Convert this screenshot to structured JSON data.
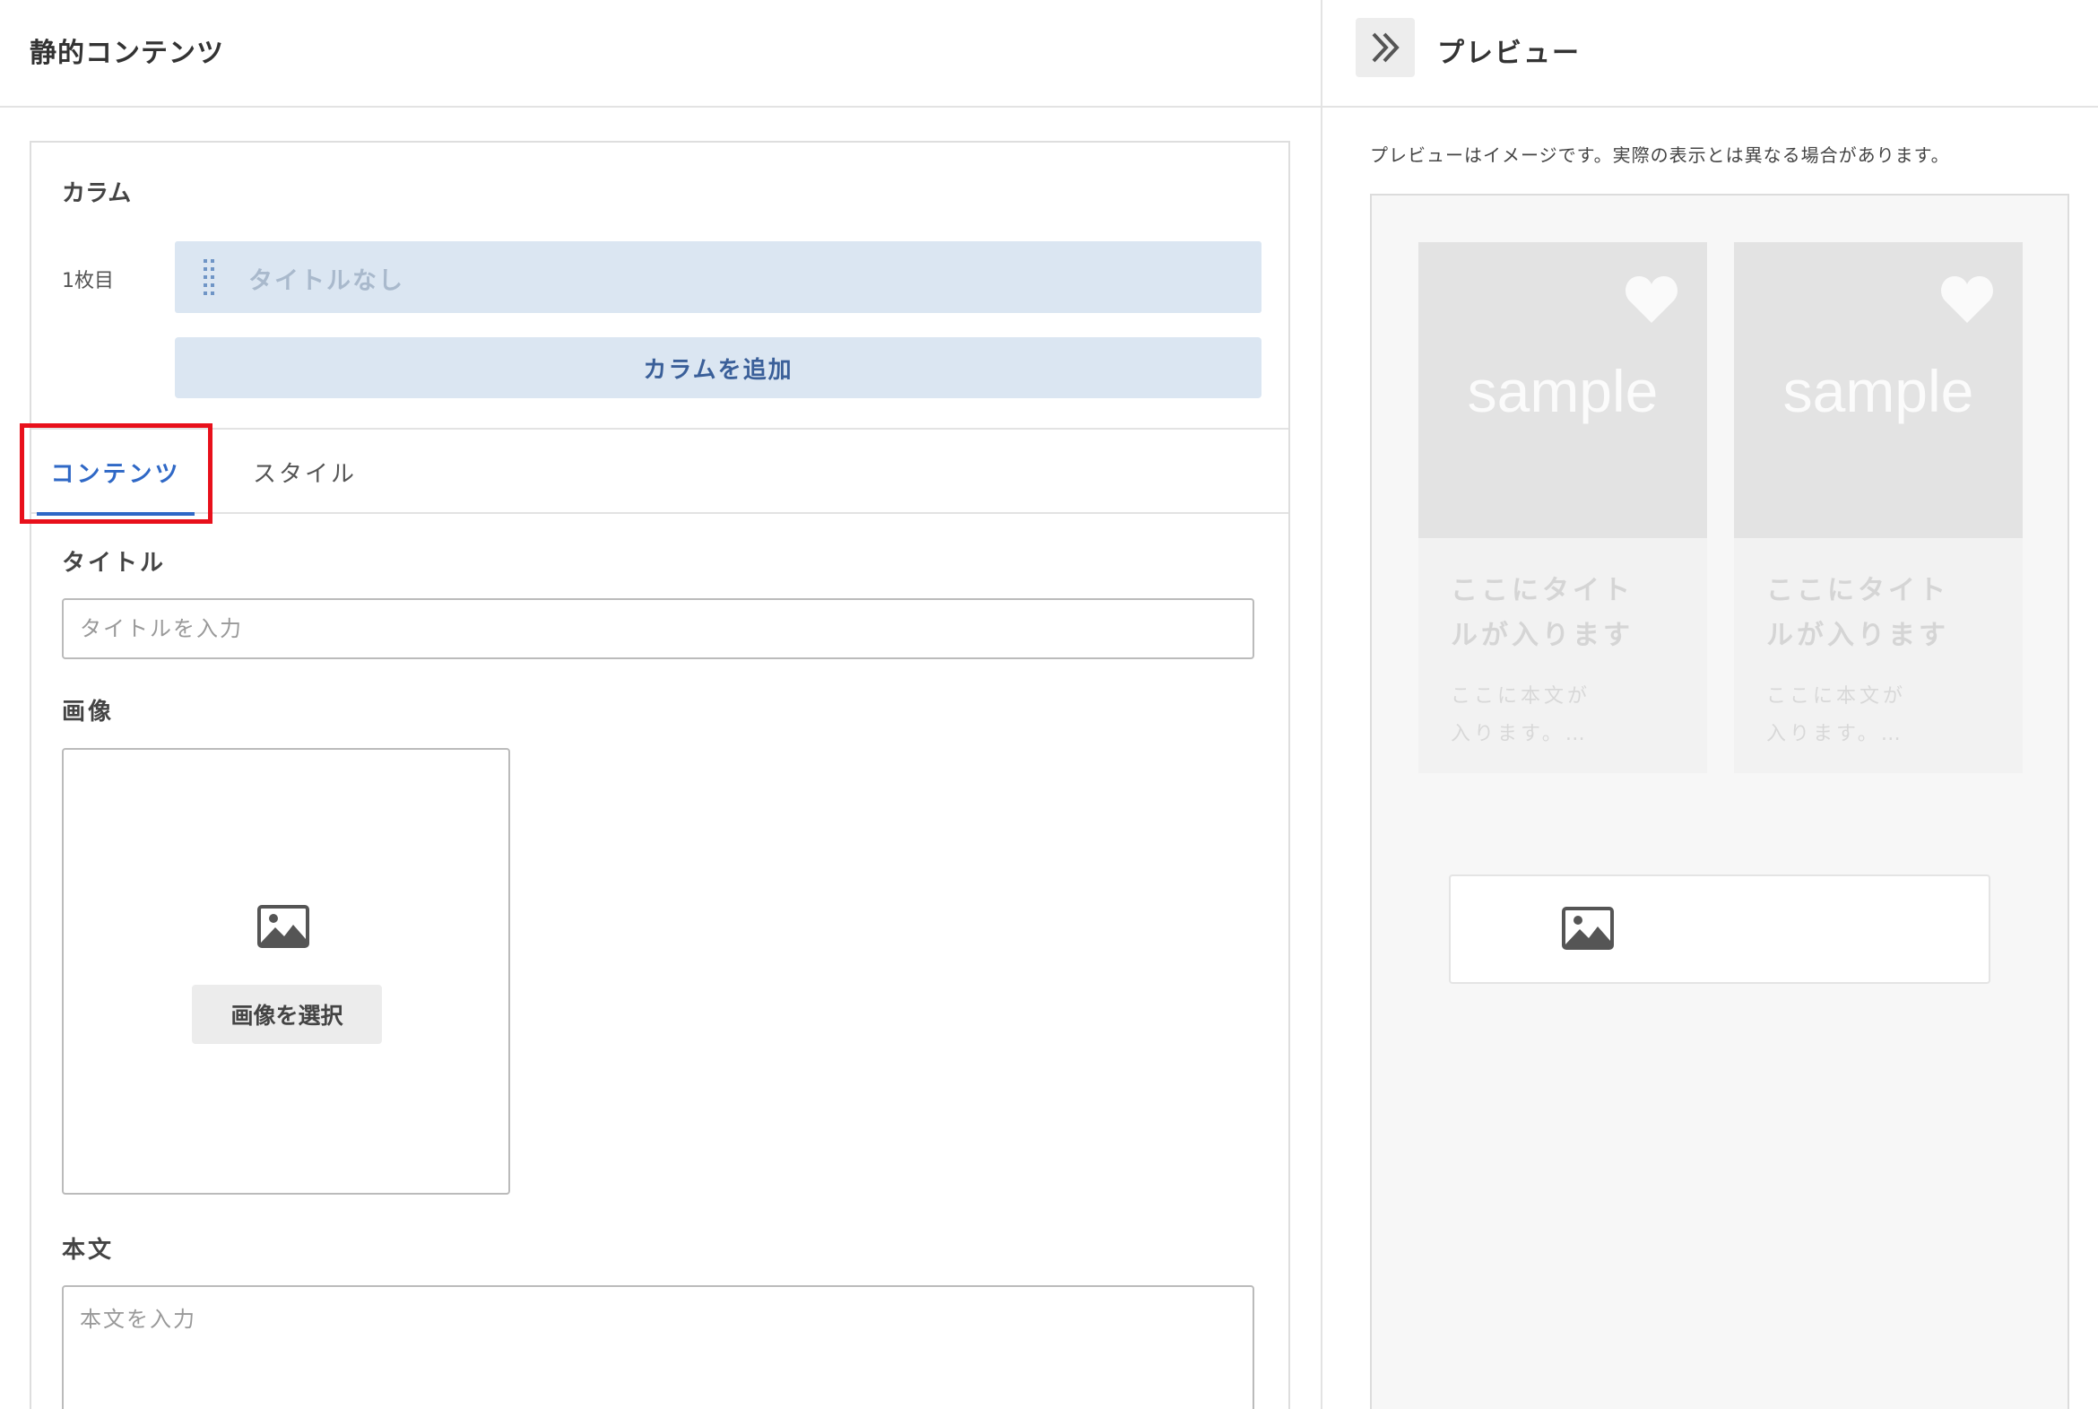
{
  "editor": {
    "title": "静的コンテンツ",
    "column_section_label": "カラム",
    "columns": [
      {
        "label": "1枚目",
        "title": "タイトルなし"
      }
    ],
    "add_column_label": "カラムを追加",
    "tabs": [
      {
        "label": "コンテンツ",
        "active": true
      },
      {
        "label": "スタイル",
        "active": false
      }
    ],
    "title_field": {
      "label": "タイトル",
      "placeholder": "タイトルを入力",
      "value": ""
    },
    "image_field": {
      "label": "画像",
      "icon": "image-icon",
      "button_label": "画像を選択"
    },
    "body_field": {
      "label": "本文",
      "placeholder": "本文を入力",
      "value": ""
    },
    "highlight_color": "#e8101b",
    "accent_color": "#2f68c6"
  },
  "preview": {
    "toggle_icon": "double-chevron-right-icon",
    "title": "プレビュー",
    "note": "プレビューはイメージです。実際の表示とは異なる場合があります。",
    "cards": [
      {
        "image_text": "sample",
        "icon": "heart-icon",
        "title_line1": "ここにタイト",
        "title_line2": "ルが入ります",
        "text_line1": "ここに本文が",
        "text_line2": "入ります。…"
      },
      {
        "image_text": "sample",
        "icon": "heart-icon",
        "title_line1": "ここにタイト",
        "title_line2": "ルが入ります",
        "text_line1": "ここに本文が",
        "text_line2": "入ります。…"
      }
    ],
    "image_placeholder_icon": "image-icon"
  }
}
